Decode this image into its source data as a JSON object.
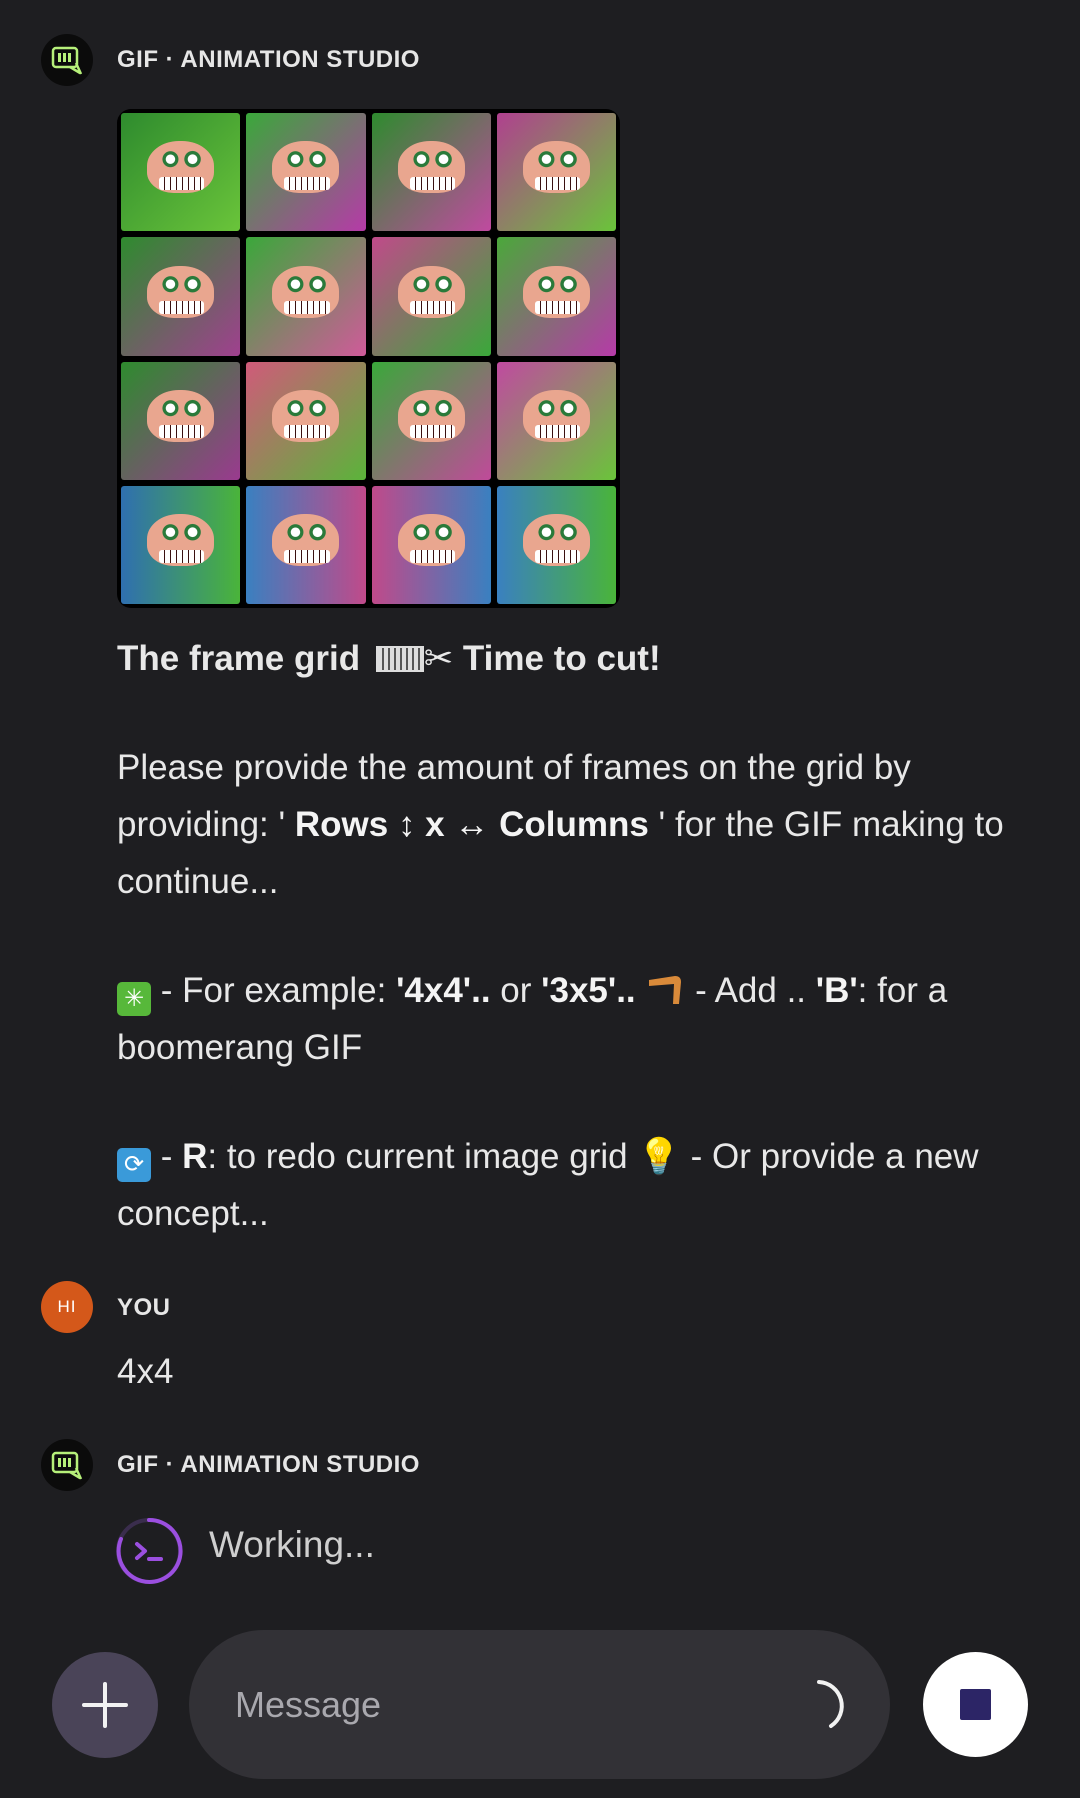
{
  "messages": [
    {
      "sender": "GIF · ANIMATION STUDIO",
      "title_part1": "The frame grid",
      "title_part2": "Time to cut!",
      "para1_a": "Please provide the amount of frames on the grid by providing: ' ",
      "para1_rows": "Rows ↕ x ↔ Columns",
      "para1_b": " ' for the GIF making to continue...",
      "example_prefix": " - For example: ",
      "example_1": "'4x4'..",
      "example_or": "  or ",
      "example_2": "'3x5'..",
      "example_add": " - Add .. ",
      "example_b": "'B'",
      "example_suffix": ": for a boomerang GIF",
      "redo_r": "R",
      "redo_text": ": to redo current image grid ",
      "redo_suffix": " -  Or provide a new concept..."
    },
    {
      "sender": "YOU",
      "avatar_initials": "HI",
      "text": "4x4"
    },
    {
      "sender": "GIF · ANIMATION STUDIO",
      "status": "Working..."
    }
  ],
  "composer": {
    "placeholder": "Message",
    "plus_icon": "plus-icon",
    "stop_icon": "stop-icon"
  },
  "colors": {
    "background": "#1e1e21",
    "user_avatar": "#d4581a",
    "accent_purple": "#9b4fe0",
    "bot_icon_green": "#b6f07a"
  }
}
